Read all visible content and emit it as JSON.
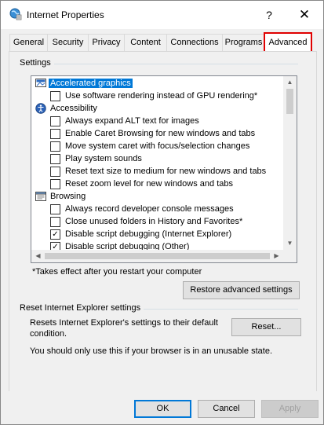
{
  "window": {
    "title": "Internet Properties",
    "help_label": "?",
    "close_label": "✕"
  },
  "tabs": [
    {
      "label": "General"
    },
    {
      "label": "Security"
    },
    {
      "label": "Privacy"
    },
    {
      "label": "Content"
    },
    {
      "label": "Connections"
    },
    {
      "label": "Programs"
    },
    {
      "label": "Advanced",
      "active": true
    }
  ],
  "settings": {
    "group_label": "Settings",
    "items": [
      {
        "type": "category",
        "icon": "accelerated-graphics-icon",
        "label": "Accelerated graphics",
        "selected": true
      },
      {
        "type": "checkbox",
        "label": "Use software rendering instead of GPU rendering*",
        "checked": false
      },
      {
        "type": "category",
        "icon": "accessibility-icon",
        "label": "Accessibility"
      },
      {
        "type": "checkbox",
        "label": "Always expand ALT text for images",
        "checked": false
      },
      {
        "type": "checkbox",
        "label": "Enable Caret Browsing for new windows and tabs",
        "checked": false
      },
      {
        "type": "checkbox",
        "label": "Move system caret with focus/selection changes",
        "checked": false
      },
      {
        "type": "checkbox",
        "label": "Play system sounds",
        "checked": false
      },
      {
        "type": "checkbox",
        "label": "Reset text size to medium for new windows and tabs",
        "checked": false
      },
      {
        "type": "checkbox",
        "label": "Reset zoom level for new windows and tabs",
        "checked": false
      },
      {
        "type": "category",
        "icon": "browsing-icon",
        "label": "Browsing"
      },
      {
        "type": "checkbox",
        "label": "Always record developer console messages",
        "checked": false
      },
      {
        "type": "checkbox",
        "label": "Close unused folders in History and Favorites*",
        "checked": false
      },
      {
        "type": "checkbox",
        "label": "Disable script debugging (Internet Explorer)",
        "checked": true
      },
      {
        "type": "checkbox",
        "label": "Disable script debugging (Other)",
        "checked": true
      }
    ],
    "note": "*Takes effect after you restart your computer",
    "restore_button": "Restore advanced settings"
  },
  "reset": {
    "group_label": "Reset Internet Explorer settings",
    "description_line1": "Resets Internet Explorer's settings to their default",
    "description_line2": "condition.",
    "warning": "You should only use this if your browser is in an unusable state.",
    "reset_button": "Reset..."
  },
  "footer": {
    "ok": "OK",
    "cancel": "Cancel",
    "apply": "Apply"
  },
  "colors": {
    "accent": "#0078d7",
    "highlight_border": "#e00000"
  }
}
